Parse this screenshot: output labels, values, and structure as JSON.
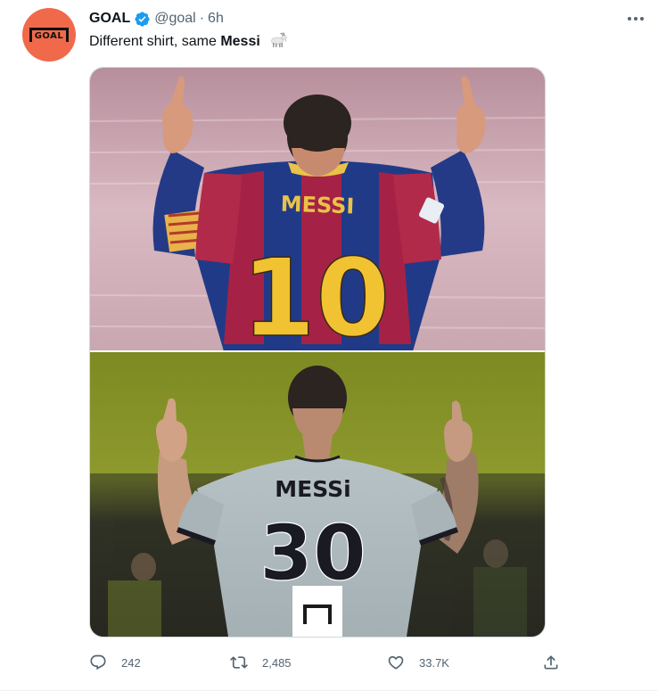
{
  "account": {
    "name": "GOAL",
    "handle": "@goal",
    "separator": "·",
    "time": "6h",
    "avatar_text": "GOAL",
    "avatar_color": "#f0694a",
    "verified_color": "#1d9bf0"
  },
  "tweet": {
    "text_plain": "Different shirt, same ",
    "text_bold": "Messi",
    "emoji": "goat-emoji"
  },
  "media": {
    "top_photo": {
      "shirt_name": "MESSI",
      "shirt_number": "10",
      "kit": "barcelona-stripes"
    },
    "bottom_photo": {
      "shirt_name": "MESSi",
      "shirt_number": "30",
      "kit": "psg-grey"
    }
  },
  "actions": {
    "reply_count": "242",
    "retweet_count": "2,485",
    "like_count": "33.7K"
  }
}
